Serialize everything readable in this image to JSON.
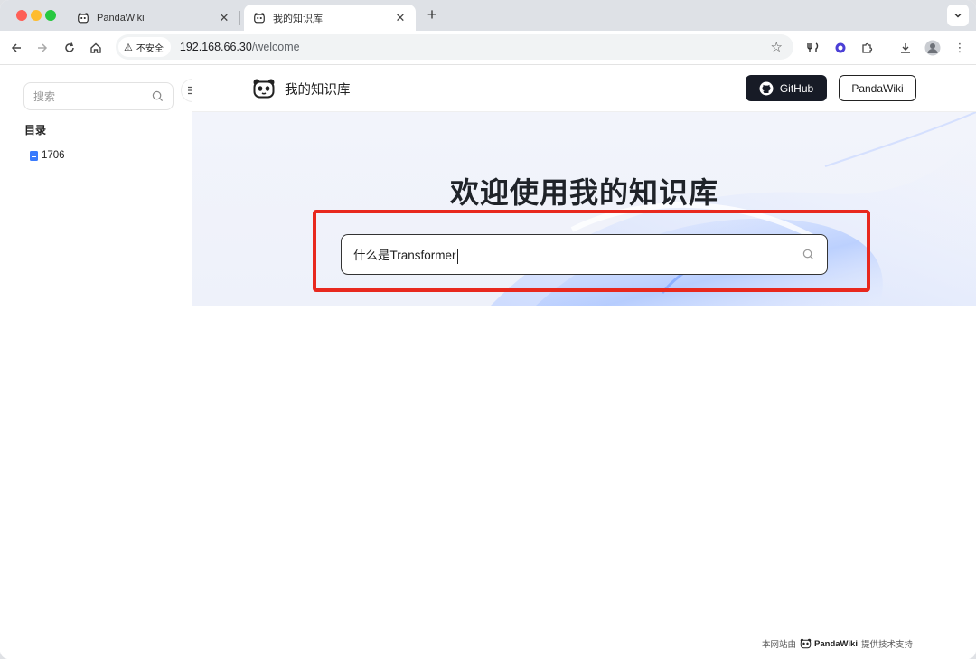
{
  "browser": {
    "tabs": [
      {
        "title": "PandaWiki",
        "active": false
      },
      {
        "title": "我的知识库",
        "active": true
      }
    ],
    "security_label": "不安全",
    "url_host": "192.168.66.30",
    "url_path": "/welcome"
  },
  "sidebar": {
    "search_placeholder": "搜索",
    "toc_title": "目录",
    "items": [
      {
        "label": "1706"
      }
    ]
  },
  "header": {
    "brand_name": "我的知识库",
    "github_label": "GitHub",
    "pandawiki_label": "PandaWiki"
  },
  "hero": {
    "title": "欢迎使用我的知识库",
    "search_value": "什么是Transformer"
  },
  "footer": {
    "prefix": "本网站由",
    "brand": "PandaWiki",
    "suffix": "提供技术支持"
  },
  "colors": {
    "highlight": "#e8281e",
    "github_button": "#171b26",
    "doc_icon": "#3a7bfd"
  }
}
